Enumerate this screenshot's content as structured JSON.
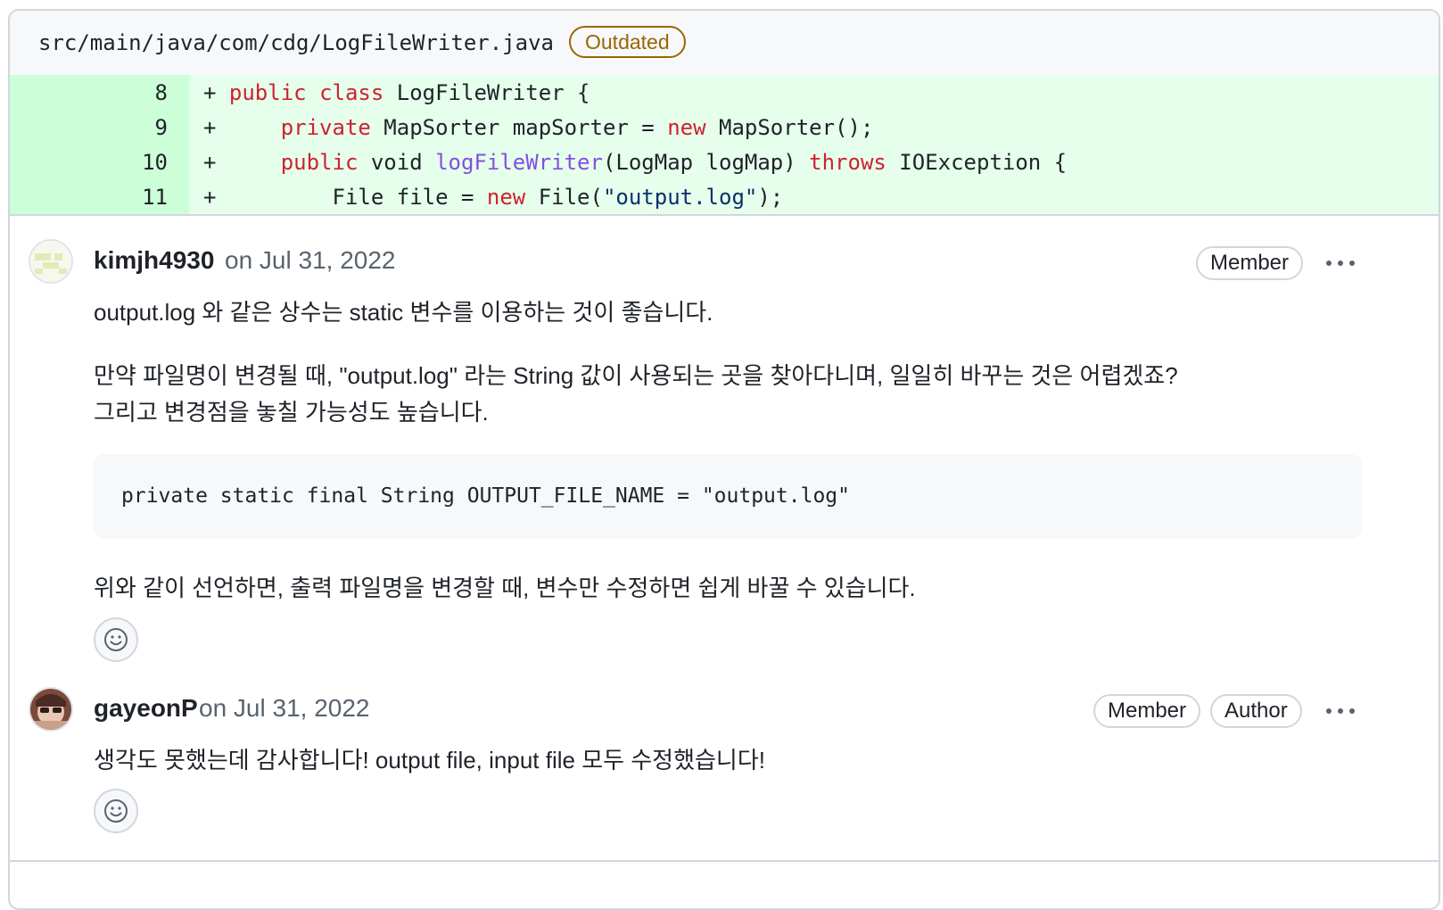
{
  "file": {
    "path": "src/main/java/com/cdg/LogFileWriter.java",
    "status_badge": "Outdated"
  },
  "diff": {
    "lines": [
      {
        "number": "8",
        "marker": "+",
        "code": "public class LogFileWriter {"
      },
      {
        "number": "9",
        "marker": "+",
        "code": "    private MapSorter mapSorter = new MapSorter();"
      },
      {
        "number": "10",
        "marker": "+",
        "code": "    public void logFileWriter(LogMap logMap) throws IOException {"
      },
      {
        "number": "11",
        "marker": "+",
        "code": "        File file = new File(\"output.log\");"
      }
    ]
  },
  "comments": [
    {
      "author": "kimjh4930",
      "date": "on Jul 31, 2022",
      "badges": [
        "Member"
      ],
      "paragraph1": "output.log 와 같은 상수는 static 변수를 이용하는 것이 좋습니다.",
      "paragraph2_line1": "만약 파일명이 변경될 때, \"output.log\" 라는 String 값이 사용되는 곳을 찾아다니며, 일일히 바꾸는 것은 어렵겠죠?",
      "paragraph2_line2": "그리고 변경점을 놓칠 가능성도 높습니다.",
      "code": "private static final String OUTPUT_FILE_NAME = \"output.log\"",
      "paragraph3": "위와 같이 선언하면, 출력 파일명을 변경할 때, 변수만 수정하면 쉽게 바꿀 수 있습니다."
    },
    {
      "author": "gayeonP",
      "date": "on Jul 31, 2022",
      "badges": [
        "Member",
        "Author"
      ],
      "paragraph1": "생각도 못했는데 감사합니다! output file, input file 모두 수정했습니다!"
    }
  ],
  "icons": {
    "more": "kebab-horizontal-icon",
    "reaction": "smiley-icon"
  },
  "colors": {
    "addition_bg": "#e6ffec",
    "addition_num_bg": "#ccffd8",
    "outdated": "#9a6700",
    "keyword": "#cf222e",
    "function": "#8250df",
    "string": "#0a3069"
  }
}
